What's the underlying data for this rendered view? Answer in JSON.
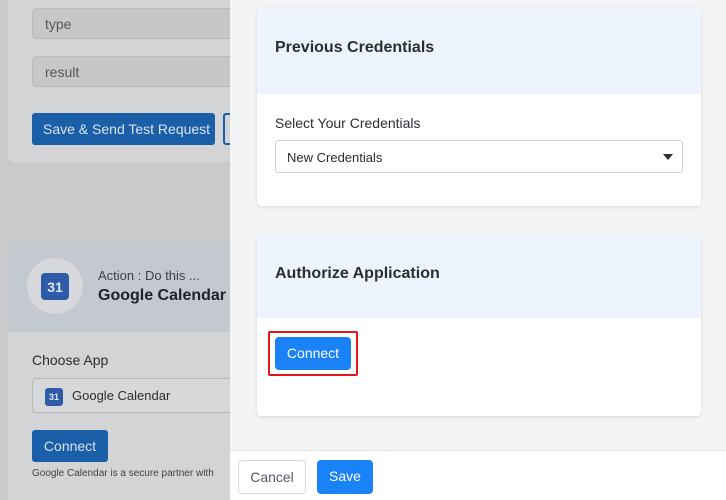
{
  "background": {
    "fields": {
      "type": "type",
      "result": "result"
    },
    "save_test_label": "Save & Send Test Request",
    "action_step": {
      "subtitle": "Action : Do this ...",
      "app_name": "Google Calendar",
      "calendar_icon_text": "31",
      "choose_app_label": "Choose App",
      "selected_app": "Google Calendar",
      "connect_label": "Connect",
      "secure_note": "Google Calendar is a secure partner with"
    }
  },
  "drawer": {
    "previous_credentials": {
      "title": "Previous Credentials",
      "select_label": "Select Your Credentials",
      "selected_value": "New Credentials"
    },
    "authorize": {
      "title": "Authorize Application",
      "connect_label": "Connect"
    },
    "footer": {
      "cancel_label": "Cancel",
      "save_label": "Save"
    }
  },
  "colors": {
    "accent": "#1a82f7",
    "highlight": "#e3161d",
    "card_header": "#edf4fd"
  }
}
